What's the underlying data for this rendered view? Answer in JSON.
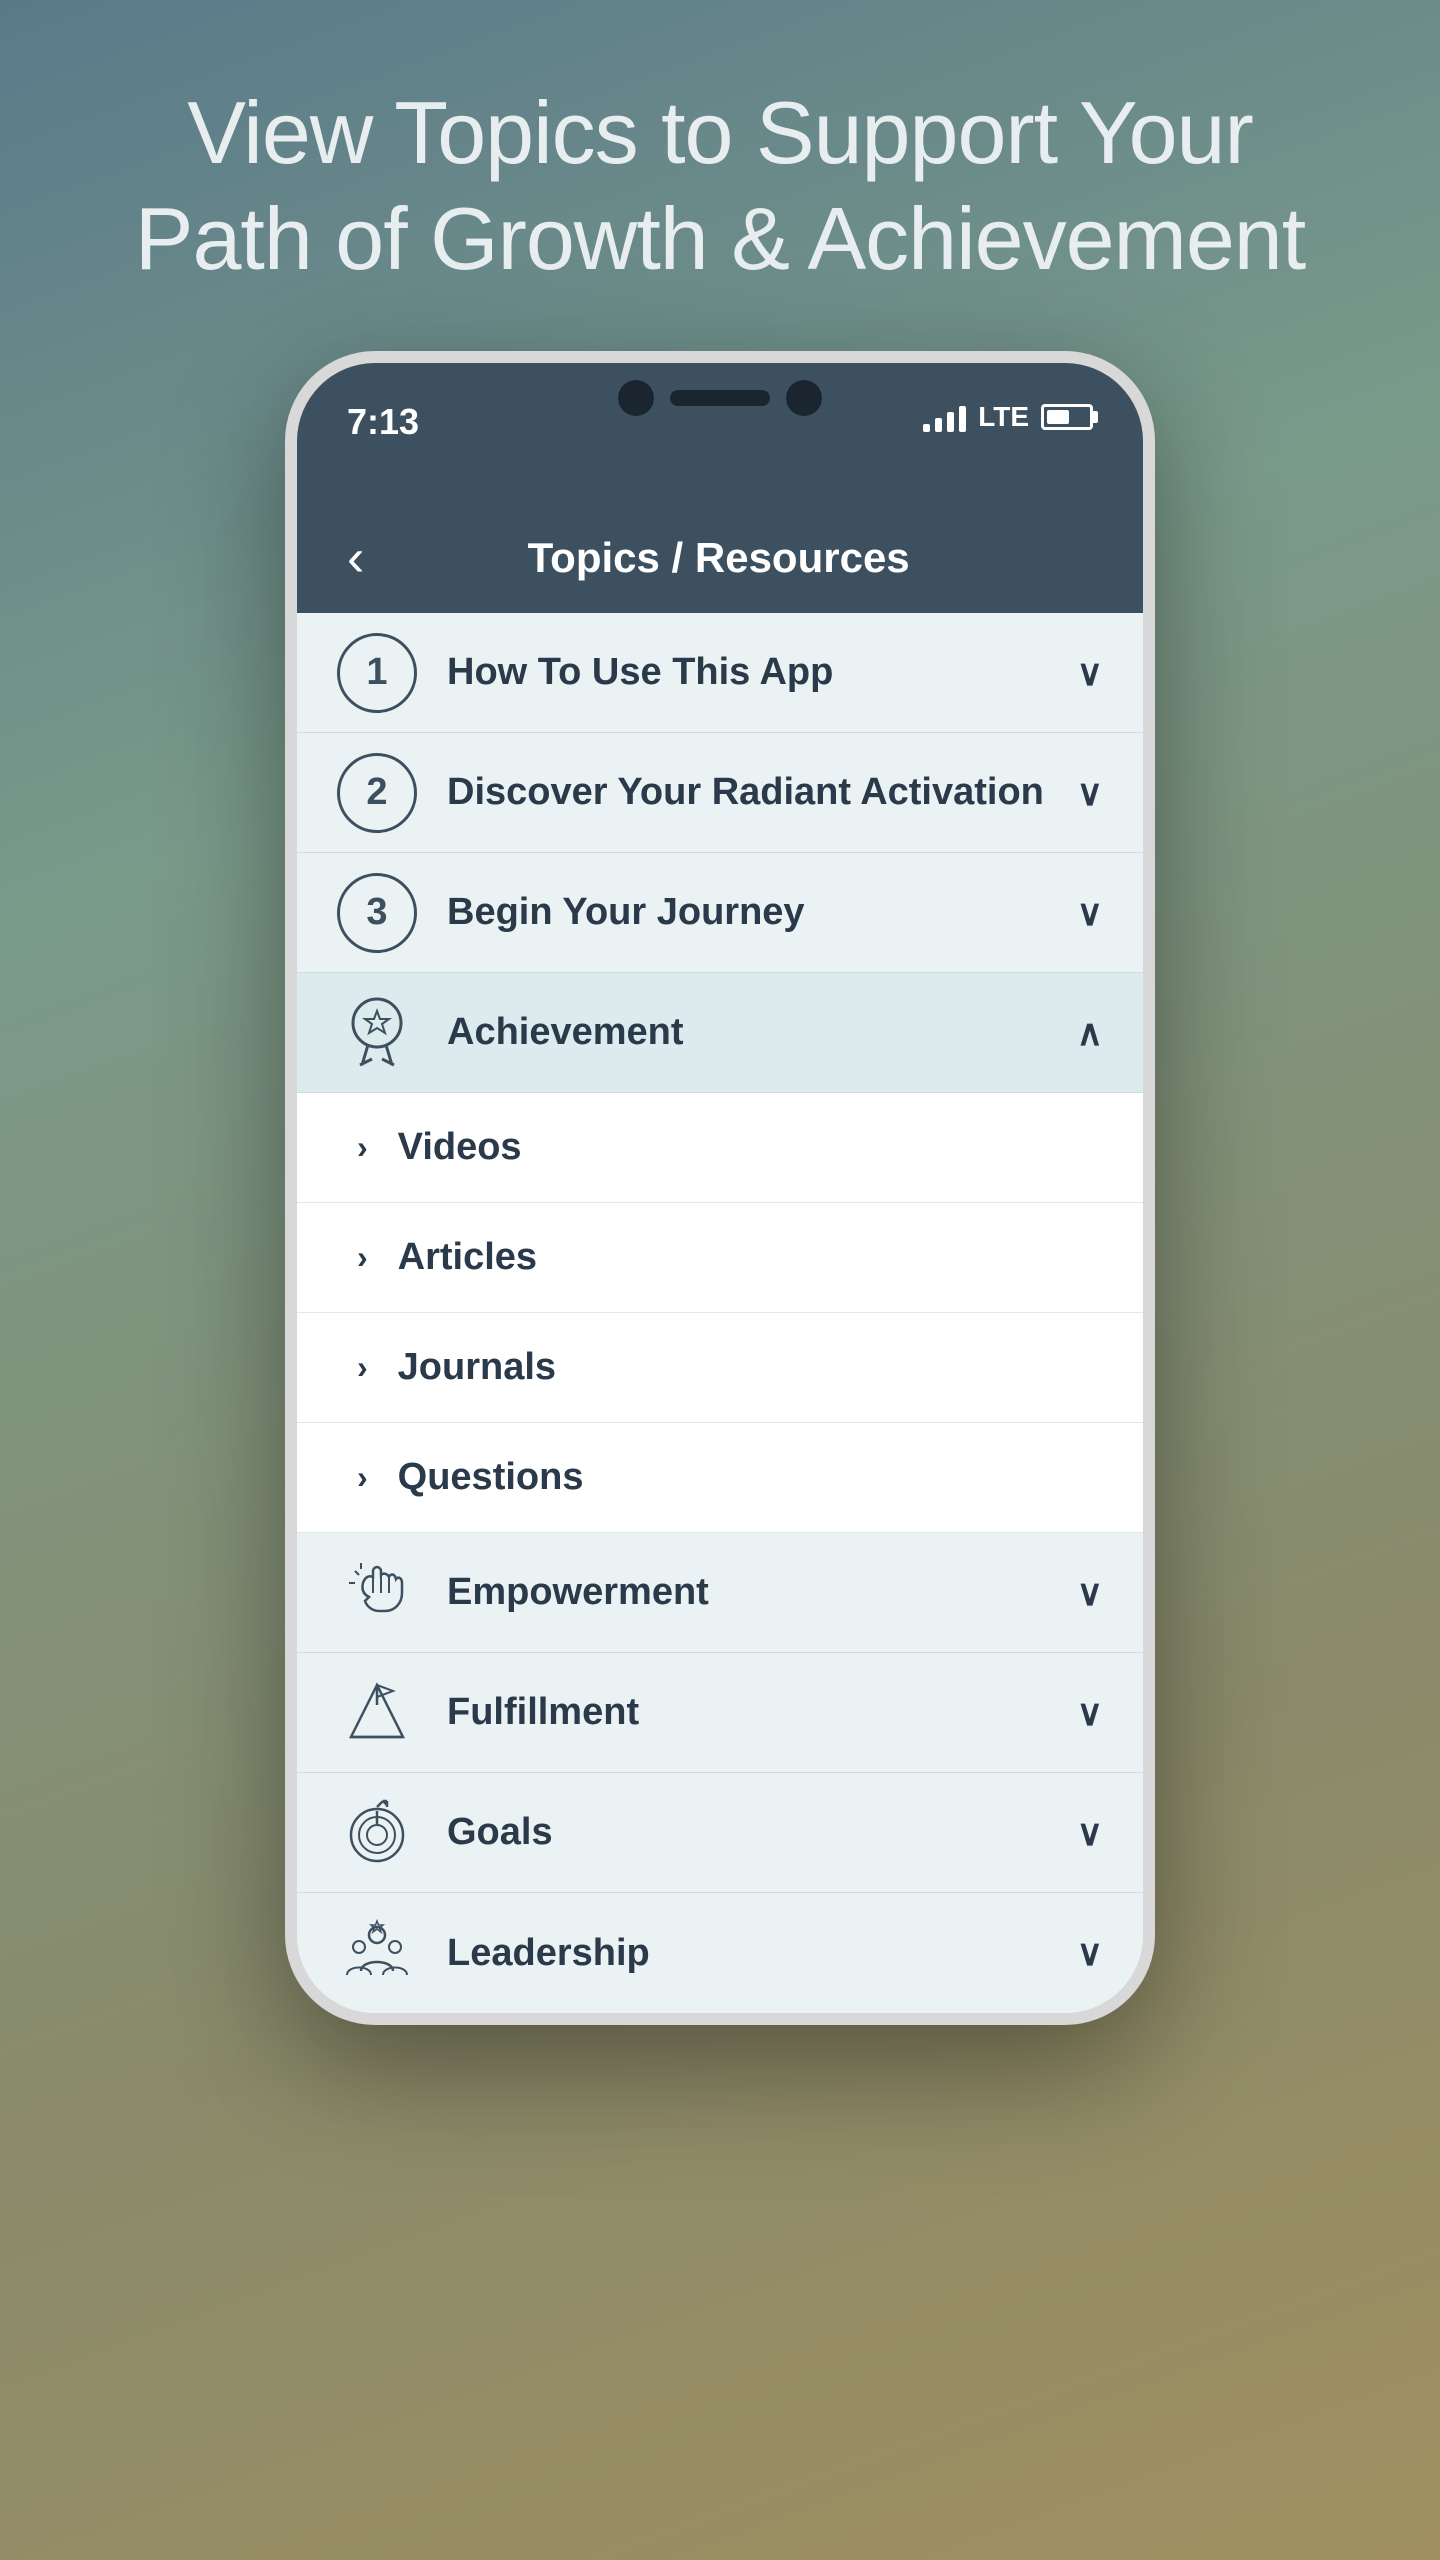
{
  "page": {
    "title_line1": "View Topics to Support Your",
    "title_line2": "Path of Growth & Achievement"
  },
  "status_bar": {
    "time": "7:13",
    "lte": "LTE"
  },
  "nav": {
    "back_label": "‹",
    "title": "Topics / Resources"
  },
  "topics": [
    {
      "id": "how-to-use",
      "number": "1",
      "label": "How To Use This App",
      "icon_type": "number",
      "expanded": false,
      "chevron": "∨"
    },
    {
      "id": "discover",
      "number": "2",
      "label": "Discover Your Radiant Activation",
      "icon_type": "number",
      "expanded": false,
      "chevron": "∨"
    },
    {
      "id": "begin-journey",
      "number": "3",
      "label": "Begin Your Journey",
      "icon_type": "number",
      "expanded": false,
      "chevron": "∨"
    },
    {
      "id": "achievement",
      "number": null,
      "label": "Achievement",
      "icon_type": "achievement",
      "expanded": true,
      "chevron": "∧",
      "sub_items": [
        {
          "id": "videos",
          "label": "Videos"
        },
        {
          "id": "articles",
          "label": "Articles"
        },
        {
          "id": "journals",
          "label": "Journals"
        },
        {
          "id": "questions",
          "label": "Questions"
        }
      ]
    },
    {
      "id": "empowerment",
      "number": null,
      "label": "Empowerment",
      "icon_type": "empowerment",
      "expanded": false,
      "chevron": "∨"
    },
    {
      "id": "fulfillment",
      "number": null,
      "label": "Fulfillment",
      "icon_type": "fulfillment",
      "expanded": false,
      "chevron": "∨"
    },
    {
      "id": "goals",
      "number": null,
      "label": "Goals",
      "icon_type": "goals",
      "expanded": false,
      "chevron": "∨"
    },
    {
      "id": "leadership",
      "number": null,
      "label": "Leadership",
      "icon_type": "leadership",
      "expanded": false,
      "chevron": "∨"
    }
  ]
}
